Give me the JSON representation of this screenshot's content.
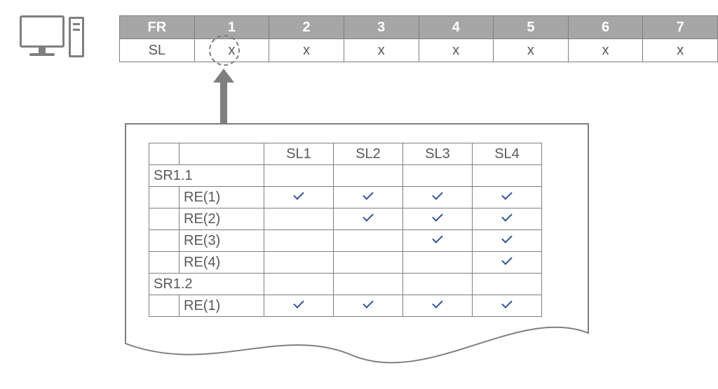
{
  "top_table": {
    "header_first": "FR",
    "headers": [
      "1",
      "2",
      "3",
      "4",
      "5",
      "6",
      "7"
    ],
    "row_label": "SL",
    "cells": [
      "x",
      "x",
      "x",
      "x",
      "x",
      "x",
      "x"
    ],
    "highlighted_column_index": 0
  },
  "detail_table": {
    "sl_headers": [
      "SL1",
      "SL2",
      "SL3",
      "SL4"
    ],
    "groups": [
      {
        "name": "SR1.1",
        "rows": [
          {
            "label": "RE(1)",
            "checks": [
              true,
              true,
              true,
              true
            ]
          },
          {
            "label": "RE(2)",
            "checks": [
              false,
              true,
              true,
              true
            ]
          },
          {
            "label": "RE(3)",
            "checks": [
              false,
              false,
              true,
              true
            ]
          },
          {
            "label": "RE(4)",
            "checks": [
              false,
              false,
              false,
              true
            ]
          }
        ]
      },
      {
        "name": "SR1.2",
        "rows": [
          {
            "label": "RE(1)",
            "checks": [
              true,
              true,
              true,
              true
            ]
          }
        ]
      }
    ]
  },
  "icons": {
    "computer": "computer-icon",
    "check": "check-icon"
  }
}
